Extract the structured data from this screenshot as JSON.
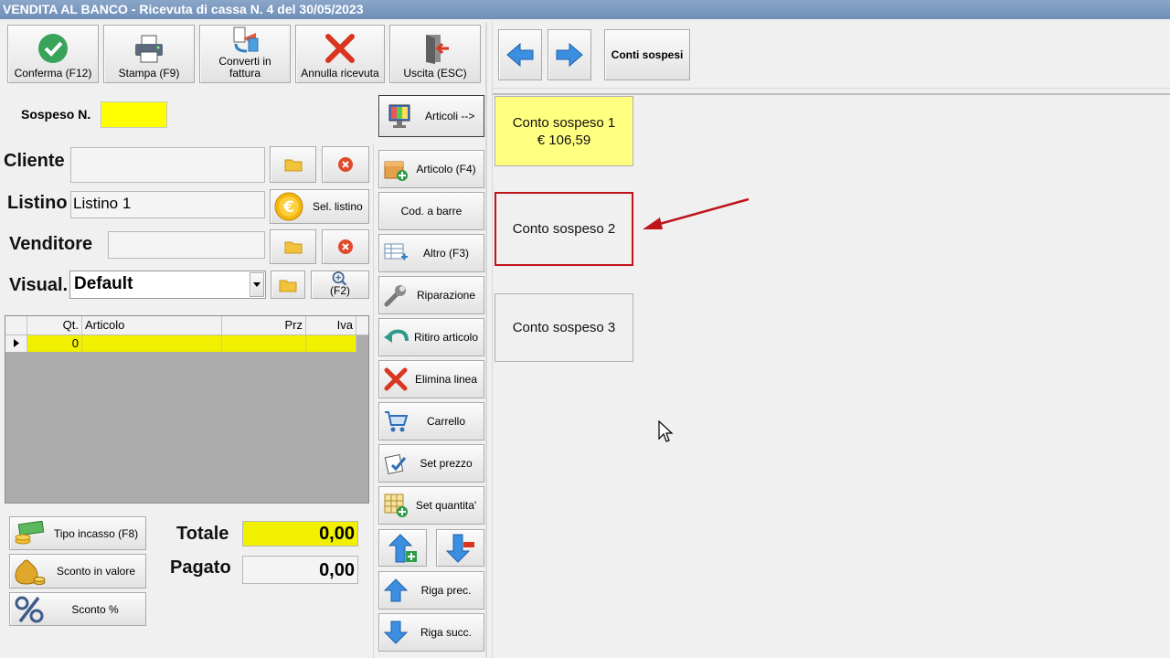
{
  "title": "VENDITA AL BANCO - Ricevuta di cassa N. 4 del 30/05/2023",
  "toolbar": {
    "conferma": "Conferma (F12)",
    "stampa": "Stampa (F9)",
    "converti_1": "Converti in",
    "converti_2": "fattura",
    "annulla": "Annulla ricevuta",
    "uscita": "Uscita (ESC)"
  },
  "right_toolbar": {
    "conti_sospesi": "Conti sospesi"
  },
  "form": {
    "sospeso_label": "Sospeso N.",
    "cliente_label": "Cliente",
    "cliente_value": "",
    "listino_label": "Listino",
    "listino_value": "Listino 1",
    "sel_listino": "Sel. listino",
    "venditore_label": "Venditore",
    "venditore_value": "",
    "visual_label": "Visual.",
    "visual_value": "Default",
    "f2_label": "(F2)"
  },
  "grid": {
    "columns": [
      "Qt.",
      "Articolo",
      "Prz",
      "Iva"
    ],
    "rows": [
      {
        "qt": "0",
        "articolo": "",
        "prz": "",
        "iva": ""
      }
    ]
  },
  "bottom": {
    "tipo_incasso": "Tipo incasso (F8)",
    "sconto_valore": "Sconto in valore",
    "sconto_perc": "Sconto %",
    "totale_label": "Totale",
    "totale_value": "0,00",
    "pagato_label": "Pagato",
    "pagato_value": "0,00"
  },
  "side_buttons": {
    "articoli_toggle": "Articoli -->",
    "articolo": "Articolo (F4)",
    "cod_barre": "Cod. a barre",
    "altro": "Altro (F3)",
    "riparazione": "Riparazione",
    "ritiro": "Ritiro articolo",
    "elimina": "Elimina linea",
    "carrello": "Carrello",
    "set_prezzo": "Set prezzo",
    "set_quantita": "Set quantita'",
    "riga_prec": "Riga prec.",
    "riga_succ": "Riga succ."
  },
  "conti": [
    {
      "label": "Conto sospeso 1",
      "amount": "€ 106,59"
    },
    {
      "label": "Conto sospeso 2",
      "amount": ""
    },
    {
      "label": "Conto sospeso 3",
      "amount": ""
    }
  ],
  "colors": {
    "highlight": "#ffff80",
    "annotation": "#c0141c",
    "title_bar": "#7d9bc1"
  }
}
